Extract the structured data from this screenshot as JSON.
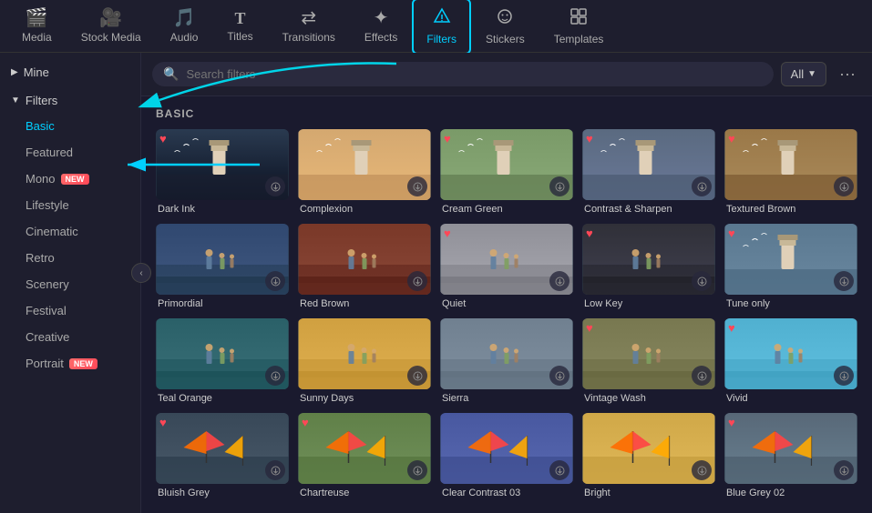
{
  "nav": {
    "items": [
      {
        "id": "media",
        "label": "Media",
        "icon": "🎬"
      },
      {
        "id": "stock-media",
        "label": "Stock Media",
        "icon": "🎥"
      },
      {
        "id": "audio",
        "label": "Audio",
        "icon": "🎵"
      },
      {
        "id": "titles",
        "label": "Titles",
        "icon": "T"
      },
      {
        "id": "transitions",
        "label": "Transitions",
        "icon": "⟐"
      },
      {
        "id": "effects",
        "label": "Effects",
        "icon": "✦"
      },
      {
        "id": "filters",
        "label": "Filters",
        "icon": "⬡",
        "active": true
      },
      {
        "id": "stickers",
        "label": "Stickers",
        "icon": "◉"
      },
      {
        "id": "templates",
        "label": "Templates",
        "icon": "⬜"
      }
    ]
  },
  "sidebar": {
    "mine_label": "Mine",
    "filters_label": "Filters",
    "items": [
      {
        "id": "basic",
        "label": "Basic",
        "active": true
      },
      {
        "id": "featured",
        "label": "Featured"
      },
      {
        "id": "mono",
        "label": "Mono",
        "badge": "NEW"
      },
      {
        "id": "lifestyle",
        "label": "Lifestyle"
      },
      {
        "id": "cinematic",
        "label": "Cinematic"
      },
      {
        "id": "retro",
        "label": "Retro"
      },
      {
        "id": "scenery",
        "label": "Scenery"
      },
      {
        "id": "festival",
        "label": "Festival"
      },
      {
        "id": "creative",
        "label": "Creative"
      },
      {
        "id": "portrait",
        "label": "Portrait",
        "badge": "NEW"
      }
    ]
  },
  "search": {
    "placeholder": "Search filters",
    "filter_label": "All"
  },
  "section": {
    "label": "BASIC"
  },
  "filters": [
    {
      "id": "dark-ink",
      "name": "Dark Ink",
      "theme": "dark-ink",
      "favorited": true,
      "row": 1
    },
    {
      "id": "complexion",
      "name": "Complexion",
      "theme": "complexion",
      "favorited": false,
      "row": 1
    },
    {
      "id": "cream-green",
      "name": "Cream Green",
      "theme": "cream-green",
      "favorited": true,
      "row": 1
    },
    {
      "id": "contrast-sharpen",
      "name": "Contrast & Sharpen",
      "theme": "contrast",
      "favorited": true,
      "row": 1
    },
    {
      "id": "textured-brown",
      "name": "Textured Brown",
      "theme": "textured",
      "favorited": true,
      "row": 1
    },
    {
      "id": "primordial",
      "name": "Primordial",
      "theme": "primordial",
      "favorited": false,
      "row": 2
    },
    {
      "id": "red-brown",
      "name": "Red Brown",
      "theme": "red-brown",
      "favorited": false,
      "row": 2
    },
    {
      "id": "quiet",
      "name": "Quiet",
      "theme": "quiet",
      "favorited": true,
      "row": 2
    },
    {
      "id": "low-key",
      "name": "Low Key",
      "theme": "low-key",
      "favorited": true,
      "row": 2
    },
    {
      "id": "tune-only",
      "name": "Tune only",
      "theme": "tune",
      "favorited": true,
      "row": 2
    },
    {
      "id": "teal-orange",
      "name": "Teal Orange",
      "theme": "teal",
      "favorited": false,
      "row": 3
    },
    {
      "id": "sunny-days",
      "name": "Sunny Days",
      "theme": "sunny",
      "favorited": false,
      "row": 3
    },
    {
      "id": "sierra",
      "name": "Sierra",
      "theme": "sierra",
      "favorited": false,
      "row": 3
    },
    {
      "id": "vintage-wash",
      "name": "Vintage Wash",
      "theme": "vintage",
      "favorited": true,
      "row": 3
    },
    {
      "id": "vivid",
      "name": "Vivid",
      "theme": "vivid",
      "favorited": true,
      "row": 3
    },
    {
      "id": "bluish-grey",
      "name": "Bluish Grey",
      "theme": "bluish",
      "favorited": true,
      "row": 4
    },
    {
      "id": "chartreuse",
      "name": "Chartreuse",
      "theme": "chartreuse",
      "favorited": true,
      "row": 4
    },
    {
      "id": "clear-contrast-03",
      "name": "Clear Contrast 03",
      "theme": "clear",
      "favorited": false,
      "row": 4
    },
    {
      "id": "bright",
      "name": "Bright",
      "theme": "bright",
      "favorited": false,
      "row": 4
    },
    {
      "id": "blue-grey-02",
      "name": "Blue Grey 02",
      "theme": "blue-grey",
      "favorited": true,
      "row": 4
    }
  ],
  "colors": {
    "active_border": "#00cfff",
    "heart": "#ff4757",
    "badge": "#ff4757"
  }
}
